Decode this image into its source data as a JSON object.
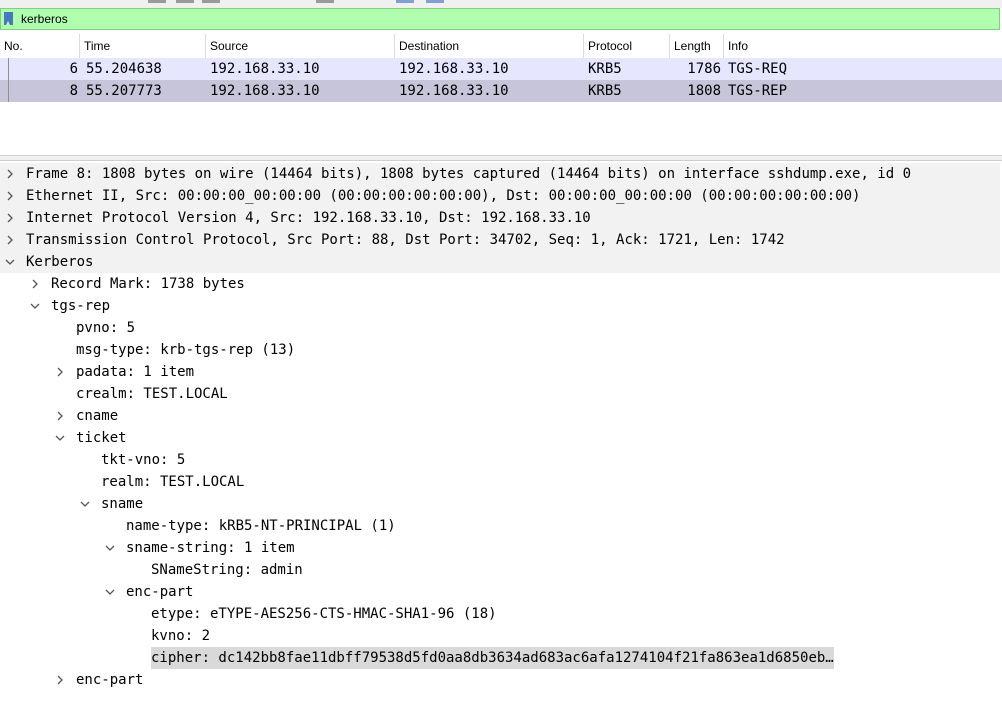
{
  "filter": {
    "value": "kerberos"
  },
  "columns": [
    "No.",
    "Time",
    "Source",
    "Destination",
    "Protocol",
    "Length",
    "Info"
  ],
  "packets": [
    {
      "no": "6",
      "time": "55.204638",
      "source": "192.168.33.10",
      "destination": "192.168.33.10",
      "protocol": "KRB5",
      "length": "1786",
      "info": "TGS-REQ"
    },
    {
      "no": "8",
      "time": "55.207773",
      "source": "192.168.33.10",
      "destination": "192.168.33.10",
      "protocol": "KRB5",
      "length": "1808",
      "info": "TGS-REP"
    }
  ],
  "colors": {
    "filter_bg": "#afffaf",
    "row_light": "#e7e6ff",
    "row_selected": "#c7c5d9",
    "tree_selected": "#d9d9d9"
  },
  "tree": [
    {
      "label": "Frame 8: 1808 bytes on wire (14464 bits), 1808 bytes captured (14464 bits) on interface sshdump.exe, id 0",
      "toggle": "collapsed"
    },
    {
      "label": "Ethernet II, Src: 00:00:00_00:00:00 (00:00:00:00:00:00), Dst: 00:00:00_00:00:00 (00:00:00:00:00:00)",
      "toggle": "collapsed"
    },
    {
      "label": "Internet Protocol Version 4, Src: 192.168.33.10, Dst: 192.168.33.10",
      "toggle": "collapsed"
    },
    {
      "label": "Transmission Control Protocol, Src Port: 88, Dst Port: 34702, Seq: 1, Ack: 1721, Len: 1742",
      "toggle": "collapsed"
    },
    {
      "label": "Kerberos",
      "toggle": "expanded"
    },
    {
      "label": "Record Mark: 1738 bytes",
      "toggle": "collapsed"
    },
    {
      "label": "tgs-rep",
      "toggle": "expanded"
    },
    {
      "label": "pvno: 5",
      "toggle": "none"
    },
    {
      "label": "msg-type: krb-tgs-rep (13)",
      "toggle": "none"
    },
    {
      "label": "padata: 1 item",
      "toggle": "collapsed"
    },
    {
      "label": "crealm: TEST.LOCAL",
      "toggle": "none"
    },
    {
      "label": "cname",
      "toggle": "collapsed"
    },
    {
      "label": "ticket",
      "toggle": "expanded"
    },
    {
      "label": "tkt-vno: 5",
      "toggle": "none"
    },
    {
      "label": "realm: TEST.LOCAL",
      "toggle": "none"
    },
    {
      "label": "sname",
      "toggle": "expanded"
    },
    {
      "label": "name-type: kRB5-NT-PRINCIPAL (1)",
      "toggle": "none"
    },
    {
      "label": "sname-string: 1 item",
      "toggle": "expanded"
    },
    {
      "label": "SNameString: admin",
      "toggle": "none"
    },
    {
      "label": "enc-part",
      "toggle": "expanded"
    },
    {
      "label": "etype: eTYPE-AES256-CTS-HMAC-SHA1-96 (18)",
      "toggle": "none"
    },
    {
      "label": "kvno: 2",
      "toggle": "none"
    },
    {
      "label": "cipher: dc142bb8fae11dbff79538d5fd0aa8db3634ad683ac6afa1274104f21fa863ea1d6850eb…",
      "toggle": "none"
    },
    {
      "label": "enc-part",
      "toggle": "collapsed"
    }
  ]
}
